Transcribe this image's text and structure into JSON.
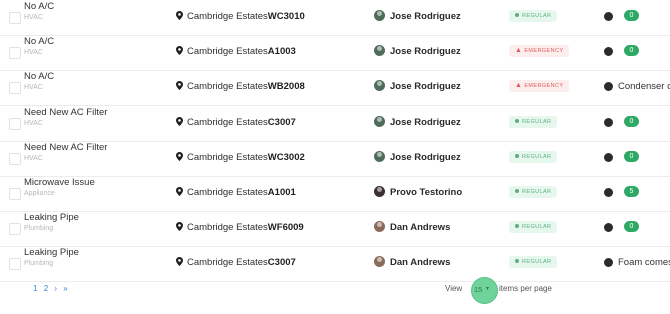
{
  "rows": [
    {
      "title": "No A/C",
      "category": "HVAC",
      "location": "Cambridge Estates",
      "unit": "WC3010",
      "user": "Jose Rodriguez",
      "avatar_color": "#4f6b5a",
      "badge": "REGULAR",
      "badge_type": "regular",
      "count": "0",
      "comment": ""
    },
    {
      "title": "No A/C",
      "category": "HVAC",
      "location": "Cambridge Estates",
      "unit": "A1003",
      "user": "Jose Rodriguez",
      "avatar_color": "#4f6b5a",
      "badge": "EMERGENCY",
      "badge_type": "emergency",
      "count": "0",
      "comment": ""
    },
    {
      "title": "No A/C",
      "category": "HVAC",
      "location": "Cambridge Estates",
      "unit": "WB2008",
      "user": "Jose Rodriguez",
      "avatar_color": "#4f6b5a",
      "badge": "EMERGENCY",
      "badge_type": "emergency",
      "count": "",
      "comment": "Condenser o"
    },
    {
      "title": "Need New AC Filter",
      "category": "HVAC",
      "location": "Cambridge Estates",
      "unit": "C3007",
      "user": "Jose Rodriguez",
      "avatar_color": "#4f6b5a",
      "badge": "REGULAR",
      "badge_type": "regular",
      "count": "0",
      "comment": ""
    },
    {
      "title": "Need New AC Filter",
      "category": "HVAC",
      "location": "Cambridge Estates",
      "unit": "WC3002",
      "user": "Jose Rodriguez",
      "avatar_color": "#4f6b5a",
      "badge": "REGULAR",
      "badge_type": "regular",
      "count": "0",
      "comment": ""
    },
    {
      "title": "Microwave Issue",
      "category": "Appliance",
      "location": "Cambridge Estates",
      "unit": "A1001",
      "user": "Provo Testorino",
      "avatar_color": "#3a3030",
      "badge": "REGULAR",
      "badge_type": "regular",
      "count": "5",
      "comment": ""
    },
    {
      "title": "Leaking Pipe",
      "category": "Plumbing",
      "location": "Cambridge Estates",
      "unit": "WF6009",
      "user": "Dan Andrews",
      "avatar_color": "#8a6a5a",
      "badge": "REGULAR",
      "badge_type": "regular",
      "count": "0",
      "comment": ""
    },
    {
      "title": "Leaking Pipe",
      "category": "Plumbing",
      "location": "Cambridge Estates",
      "unit": "C3007",
      "user": "Dan Andrews",
      "avatar_color": "#8a6a5a",
      "badge": "REGULAR",
      "badge_type": "regular",
      "count": "",
      "comment": "Foam comes"
    }
  ],
  "pagination": {
    "page1": "1",
    "page2": "2",
    "next": "›",
    "last": "»"
  },
  "view": {
    "label": "View",
    "per_page_value": "15",
    "per_page_caret": "▾",
    "suffix": "items per page"
  }
}
